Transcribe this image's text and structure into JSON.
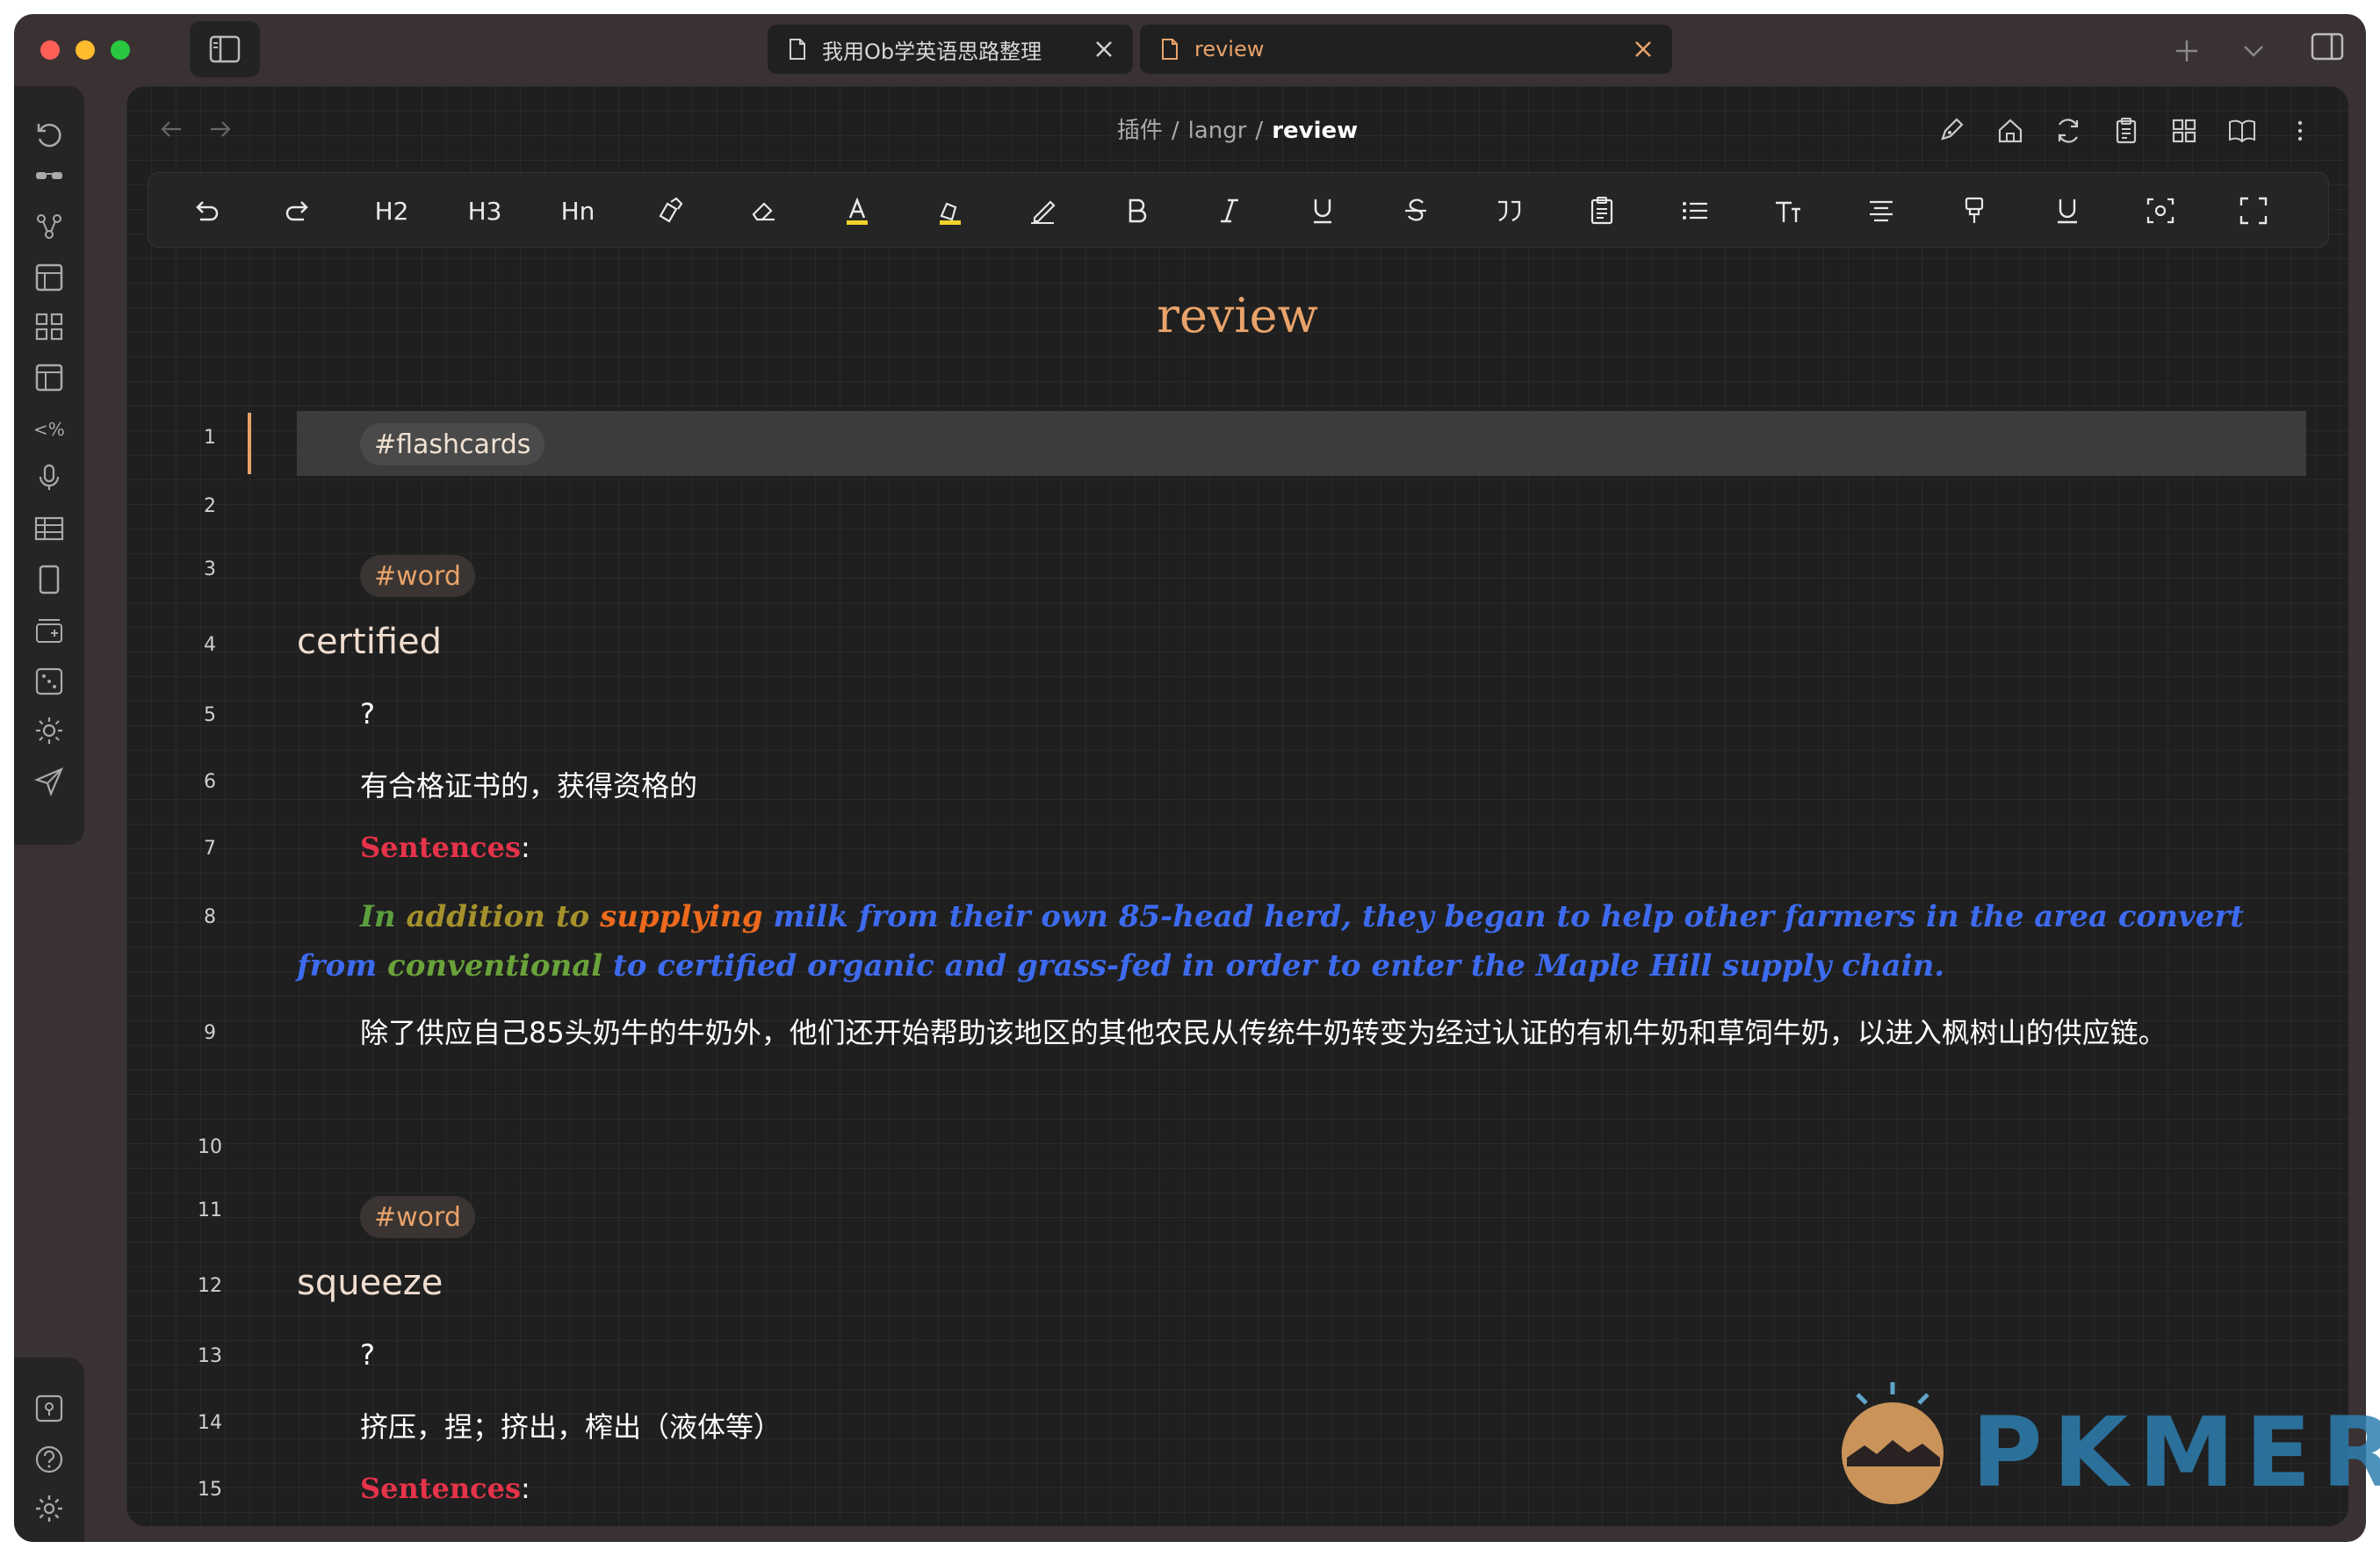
{
  "titlebar": {
    "tabs": [
      {
        "label": "我用Ob学英语思路整理",
        "active": false
      },
      {
        "label": "review",
        "active": true
      }
    ]
  },
  "breadcrumb": {
    "parts": [
      "插件",
      "langr"
    ],
    "current": "review",
    "separator": "/"
  },
  "toolbar": {
    "h2": "H2",
    "h3": "H3",
    "hn": "Hn"
  },
  "document": {
    "title": "review",
    "line_numbers": [
      "1",
      "2",
      "3",
      "4",
      "5",
      "6",
      "7",
      "8",
      "9",
      "10",
      "11",
      "12",
      "13",
      "14",
      "15"
    ],
    "tag_flashcards": "#flashcards",
    "word1": {
      "tag": "#word",
      "heading": "certified",
      "question": "?",
      "meaning": "有合格证书的，获得资格的",
      "sentences_label": "Sentences",
      "colon": ":",
      "example_parts": {
        "p1": "In ",
        "p2": "addition ",
        "p3": "to ",
        "p4": "supplying ",
        "p5": "milk from their own 85-head herd, they began to help other farmers in the area convert from ",
        "p6": "conventional ",
        "p7": "to certified organic and grass-fed in order to enter the Maple Hill supply chain."
      },
      "translation": "除了供应自己85头奶牛的牛奶外，他们还开始帮助该地区的其他农民从传统牛奶转变为经过认证的有机牛奶和草饲牛奶，以进入枫树山的供应链。"
    },
    "word2": {
      "tag": "#word",
      "heading": "squeeze",
      "question": "?",
      "meaning": "挤压，捏；挤出，榨出（液体等）",
      "sentences_label": "Sentences",
      "colon": ":"
    }
  },
  "watermark": {
    "text": "PKMER"
  },
  "colors": {
    "accent": "#e9a36a",
    "sentences": "#e6334a",
    "example_blue": "#3d6bf0"
  }
}
